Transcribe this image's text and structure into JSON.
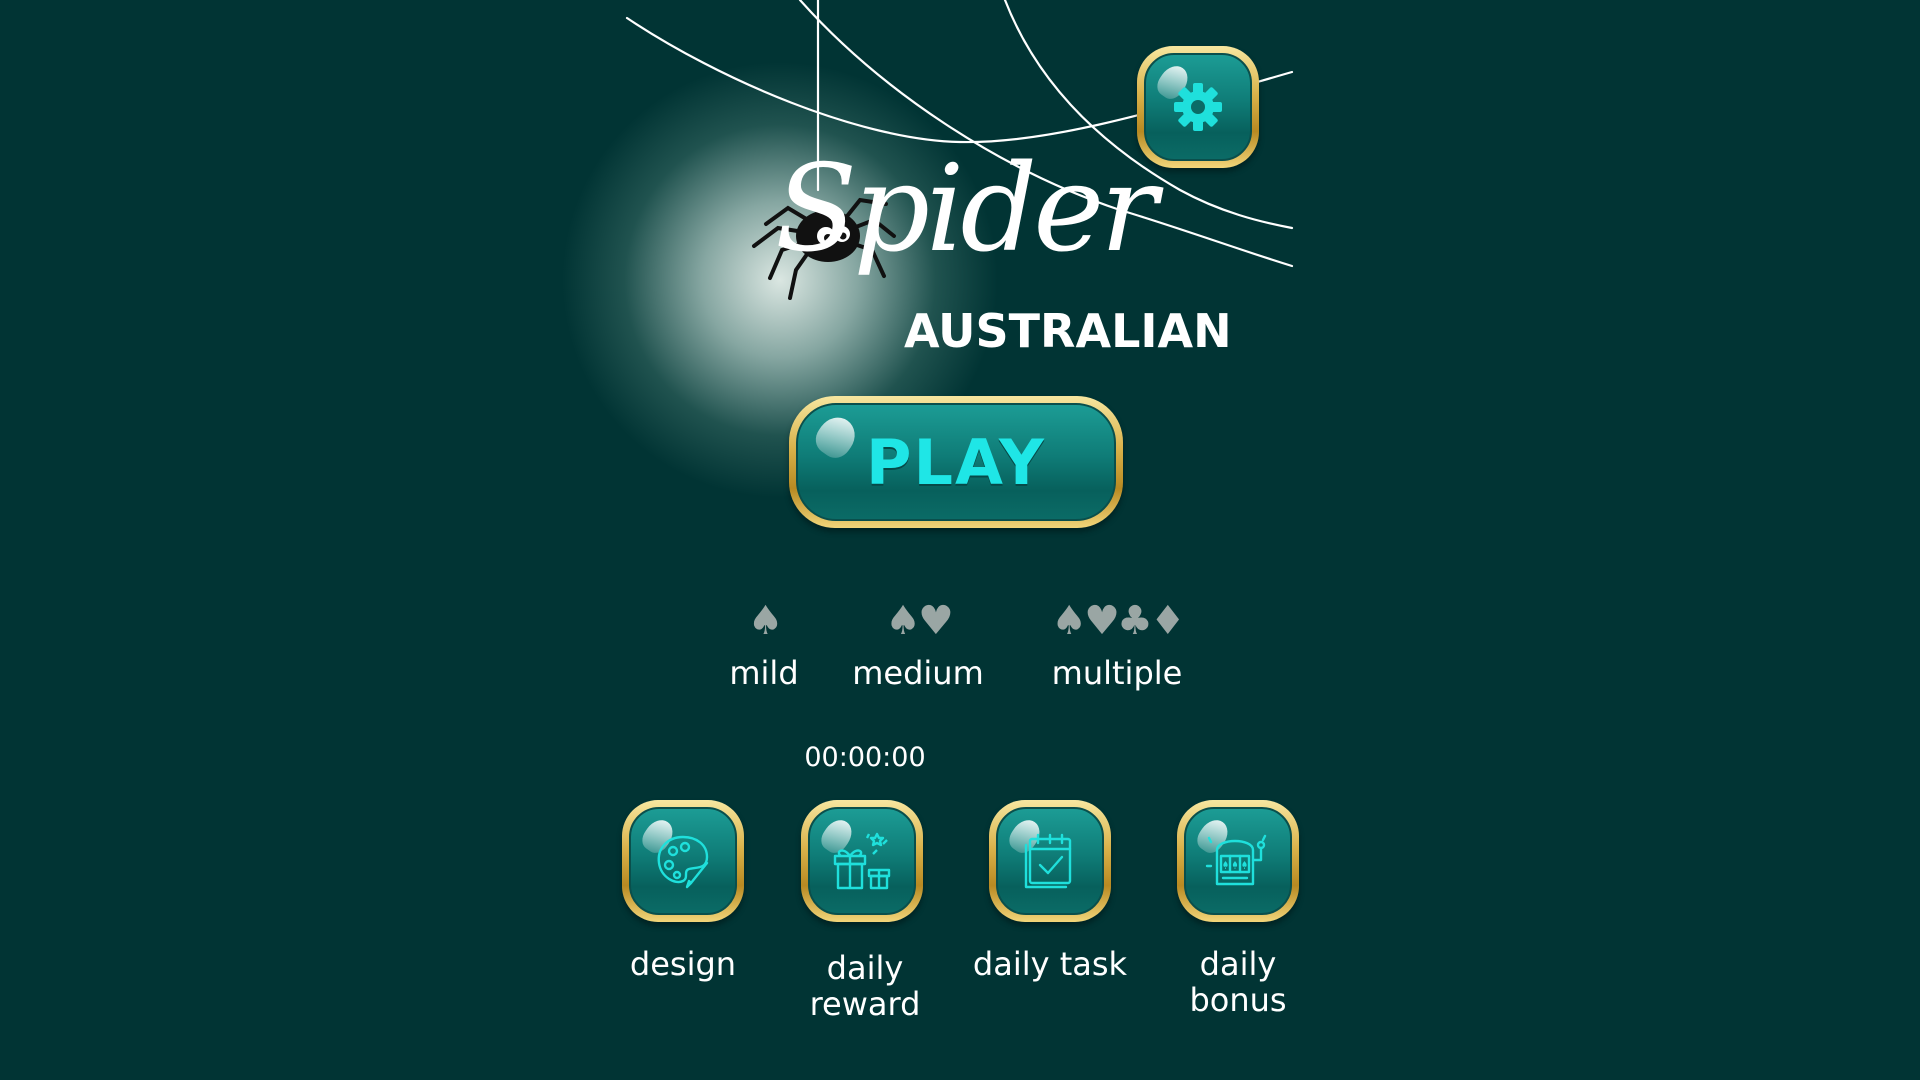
{
  "logo": {
    "title": "Spider",
    "subtitle": "AUSTRALIAN"
  },
  "settings": {
    "icon": "gear-icon"
  },
  "play_button": {
    "label": "PLAY"
  },
  "difficulties": [
    {
      "label": "mild",
      "suits": "♠"
    },
    {
      "label": "medium",
      "suits": "♠♥"
    },
    {
      "label": "multiple",
      "suits": "♠♥♣♦"
    }
  ],
  "timer": "00:00:00",
  "bottom_buttons": [
    {
      "label": "design",
      "icon": "palette-icon"
    },
    {
      "label": "daily\nreward",
      "line1": "daily",
      "line2": "reward",
      "icon": "gift-icon"
    },
    {
      "label": "daily task",
      "icon": "calendar-check-icon"
    },
    {
      "label": "daily\nbonus",
      "line1": "daily",
      "line2": "bonus",
      "icon": "slot-machine-icon"
    }
  ],
  "colors": {
    "background": "#013434",
    "button_face": "#0f7c77",
    "button_rim": "#d9b24a",
    "play_text": "#1fe6e6",
    "suit_gray": "#9aa6a4"
  }
}
